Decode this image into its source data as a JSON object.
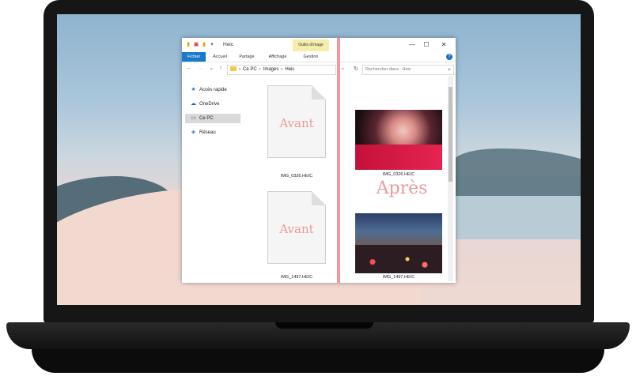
{
  "window": {
    "title": "Heic",
    "contextual_tab": "Outils d'image",
    "controls": [
      "—",
      "☐",
      "✕"
    ]
  },
  "ribbon": {
    "tabs": [
      "Fichier",
      "Accueil",
      "Partage",
      "Affichage",
      "Gestion"
    ],
    "help": "?"
  },
  "addressbar": {
    "path": [
      "Ce PC",
      "Images",
      "Heic"
    ],
    "separator": "›",
    "search_placeholder": "Rechercher dans : Heic"
  },
  "nav": {
    "items": [
      {
        "label": "Accès rapide",
        "icon": "star-icon"
      },
      {
        "label": "OneDrive",
        "icon": "cloud-icon"
      },
      {
        "label": "Ce PC",
        "icon": "computer-icon",
        "selected": true
      },
      {
        "label": "Réseau",
        "icon": "network-icon"
      }
    ]
  },
  "files_before": [
    {
      "name": "IMG_0326.HEIC",
      "stamp": "Avant"
    },
    {
      "name": "IMG_1497.HEIC",
      "stamp": "Avant"
    }
  ],
  "files_after": [
    {
      "name": "IMG_0326.HEIC",
      "icon": "portrait-thumbnail"
    },
    {
      "name": "IMG_1497.HEIC",
      "icon": "city-night-thumbnail"
    }
  ],
  "after_label": "Après",
  "colors": {
    "accent": "#1979ca",
    "stamp": "#ea9b9b",
    "divider": "#f09a9f"
  }
}
